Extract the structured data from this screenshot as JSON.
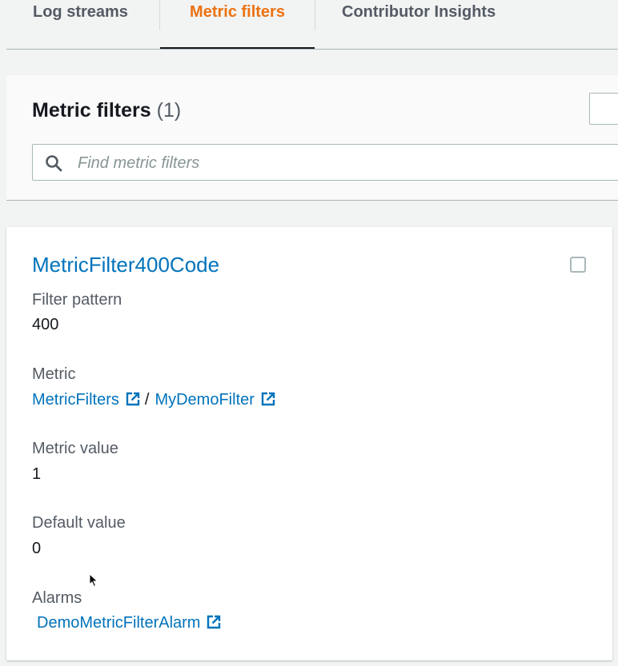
{
  "tabs": [
    {
      "label": "Log streams",
      "active": false
    },
    {
      "label": "Metric filters",
      "active": true
    },
    {
      "label": "Contributor Insights",
      "active": false
    }
  ],
  "header": {
    "title": "Metric filters",
    "count": "(1)"
  },
  "search": {
    "placeholder": "Find metric filters",
    "icon": "search-icon"
  },
  "filter": {
    "name": "MetricFilter400Code",
    "selected": false,
    "filter_pattern_label": "Filter pattern",
    "filter_pattern": "400",
    "metric_label": "Metric",
    "metric_namespace": "MetricFilters",
    "metric_separator": "/",
    "metric_name": "MyDemoFilter",
    "metric_value_label": "Metric value",
    "metric_value": "1",
    "default_value_label": "Default value",
    "default_value": "0",
    "alarms_label": "Alarms",
    "alarm_name": "DemoMetricFilterAlarm"
  },
  "colors": {
    "accent_orange": "#ec7211",
    "link_blue": "#0073bb",
    "text": "#16191f",
    "muted": "#545b64"
  }
}
